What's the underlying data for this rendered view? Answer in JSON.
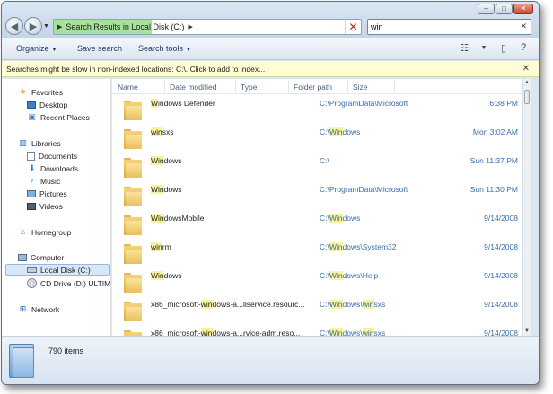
{
  "window": {
    "caption_buttons": [
      "–",
      "□",
      "✕"
    ]
  },
  "address": {
    "crumb": "Search Results in Local Disk (C:)",
    "progress_fraction": 0.32
  },
  "search": {
    "value": "win",
    "clear": "✕"
  },
  "toolbar": {
    "organize": "Organize",
    "save_search": "Save search",
    "search_tools": "Search tools"
  },
  "infobar": {
    "text": "Searches might be slow in non-indexed locations: C:\\. Click to add to index...",
    "close": "✕"
  },
  "nav": {
    "favorites": "Favorites",
    "desktop": "Desktop",
    "recent": "Recent Places",
    "libraries": "Libraries",
    "documents": "Documents",
    "downloads": "Downloads",
    "music": "Music",
    "pictures": "Pictures",
    "videos": "Videos",
    "homegroup": "Homegroup",
    "computer": "Computer",
    "local_disk": "Local Disk (C:)",
    "cd_drive": "CD Drive (D:) ULTIM",
    "network": "Network"
  },
  "columns": [
    "Name",
    "Date modified",
    "Type",
    "Folder path",
    "Size"
  ],
  "rows": [
    {
      "name": [
        {
          "t": "W",
          "h": true
        },
        {
          "t": "indows Defender",
          "h": false
        }
      ],
      "path": [
        {
          "t": "C:\\ProgramData\\Microsoft",
          "h": false
        }
      ],
      "date": "6:38 PM"
    },
    {
      "name": [
        {
          "t": "win",
          "h": true
        },
        {
          "t": "sxs",
          "h": false
        }
      ],
      "path": [
        {
          "t": "C:\\",
          "h": false
        },
        {
          "t": "Win",
          "h": true
        },
        {
          "t": "dows",
          "h": false
        }
      ],
      "date": "Mon 3:02 AM"
    },
    {
      "name": [
        {
          "t": "Win",
          "h": true
        },
        {
          "t": "dows",
          "h": false
        }
      ],
      "path": [
        {
          "t": "C:\\",
          "h": false
        }
      ],
      "date": "Sun 11:37 PM"
    },
    {
      "name": [
        {
          "t": "Win",
          "h": true
        },
        {
          "t": "dows",
          "h": false
        }
      ],
      "path": [
        {
          "t": "C:\\ProgramData\\Microsoft",
          "h": false
        }
      ],
      "date": "Sun 11:30 PM"
    },
    {
      "name": [
        {
          "t": "Win",
          "h": true
        },
        {
          "t": "dowsMobile",
          "h": false
        }
      ],
      "path": [
        {
          "t": "C:\\",
          "h": false
        },
        {
          "t": "Win",
          "h": true
        },
        {
          "t": "dows",
          "h": false
        }
      ],
      "date": "9/14/2008"
    },
    {
      "name": [
        {
          "t": "win",
          "h": true
        },
        {
          "t": "rm",
          "h": false
        }
      ],
      "path": [
        {
          "t": "C:\\",
          "h": false
        },
        {
          "t": "Win",
          "h": true
        },
        {
          "t": "dows\\System32",
          "h": false
        }
      ],
      "date": "9/14/2008"
    },
    {
      "name": [
        {
          "t": "Win",
          "h": true
        },
        {
          "t": "dows",
          "h": false
        }
      ],
      "path": [
        {
          "t": "C:\\",
          "h": false
        },
        {
          "t": "Win",
          "h": true
        },
        {
          "t": "dows\\Help",
          "h": false
        }
      ],
      "date": "9/14/2008"
    },
    {
      "name": [
        {
          "t": "x86_microsoft-",
          "h": false
        },
        {
          "t": "win",
          "h": true
        },
        {
          "t": "dows-a...llservice.resourc...",
          "h": false
        }
      ],
      "path": [
        {
          "t": "C:\\",
          "h": false
        },
        {
          "t": "Win",
          "h": true
        },
        {
          "t": "dows\\",
          "h": false
        },
        {
          "t": "win",
          "h": true
        },
        {
          "t": "sxs",
          "h": false
        }
      ],
      "date": "9/14/2008"
    },
    {
      "name": [
        {
          "t": "x86_microsoft-",
          "h": false
        },
        {
          "t": "win",
          "h": true
        },
        {
          "t": "dows-a...rvice-adm.reso...",
          "h": false
        }
      ],
      "path": [
        {
          "t": "C:\\",
          "h": false
        },
        {
          "t": "Win",
          "h": true
        },
        {
          "t": "dows\\",
          "h": false
        },
        {
          "t": "win",
          "h": true
        },
        {
          "t": "sxs",
          "h": false
        }
      ],
      "date": "9/14/2008"
    }
  ],
  "details": {
    "count": "790 items"
  }
}
